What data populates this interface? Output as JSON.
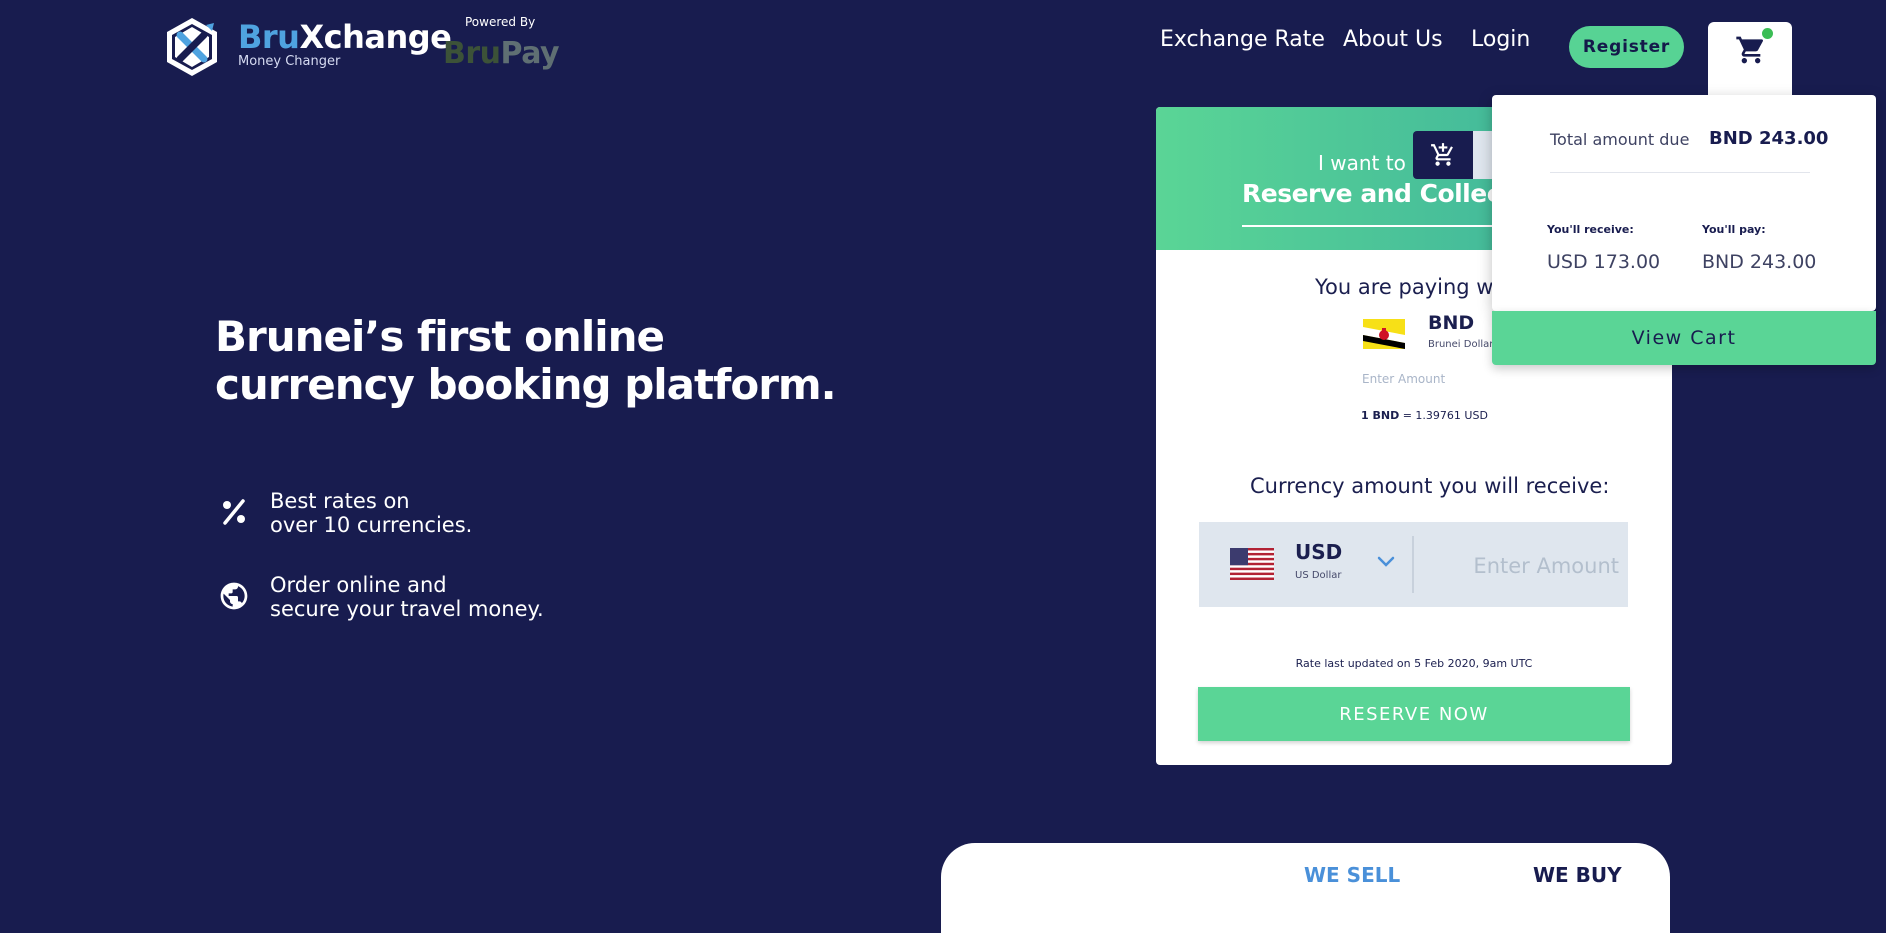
{
  "brand": {
    "name_part1": "Bru",
    "name_part2": "Xchange",
    "tagline": "Money Changer",
    "powered_by": "Powered By",
    "partner_part1": "Bru",
    "partner_part2": "Pay",
    "logo_icon": "bruxchange-logo"
  },
  "nav": {
    "exchange_rate": "Exchange Rate",
    "about_us": "About Us",
    "login": "Login",
    "register": "Register",
    "cart_icon": "cart-icon",
    "cart_badge": "notification-dot"
  },
  "hero": {
    "title_line1": "Brunei’s first online",
    "title_line2": "currency booking platform.",
    "features": [
      {
        "icon": "percent-icon",
        "line1": "Best rates on",
        "line2": "over 10 currencies."
      },
      {
        "icon": "globe-icon",
        "line1": "Order online and",
        "line2": "secure your travel money."
      }
    ]
  },
  "booking": {
    "i_want_to": "I want to",
    "mode_icon": "cart-add-icon",
    "mode_title": "Reserve and Collect C",
    "paying_with_label": "You are paying wit",
    "pay_currency": {
      "code": "BND",
      "name": "Brunei Dollar",
      "flag": "brunei-flag",
      "placeholder": "Enter Amount"
    },
    "rate_prefix": "1 BND",
    "rate_text": " = 1.39761 USD",
    "receive_label": "Currency amount you will receive:",
    "receive_currency": {
      "code": "USD",
      "name": "US Dollar",
      "flag": "us-flag",
      "placeholder": "Enter Amount"
    },
    "rate_updated": "Rate last updated on 5 Feb 2020, 9am UTC",
    "reserve_button": "RESERVE NOW"
  },
  "cart_popup": {
    "total_label": "Total amount due",
    "total_value": "BND 243.00",
    "receive_label": "You'll receive:",
    "receive_value": "USD 173.00",
    "pay_label": "You'll pay:",
    "pay_value": "BND 243.00",
    "view_cart": "View Cart"
  },
  "tabs": {
    "sell": "WE SELL",
    "buy": "WE BUY"
  },
  "colors": {
    "background": "#181c4f",
    "accent_green": "#5ad596",
    "accent_blue": "#4fa3e0",
    "text_dark": "#1b1f4f"
  }
}
